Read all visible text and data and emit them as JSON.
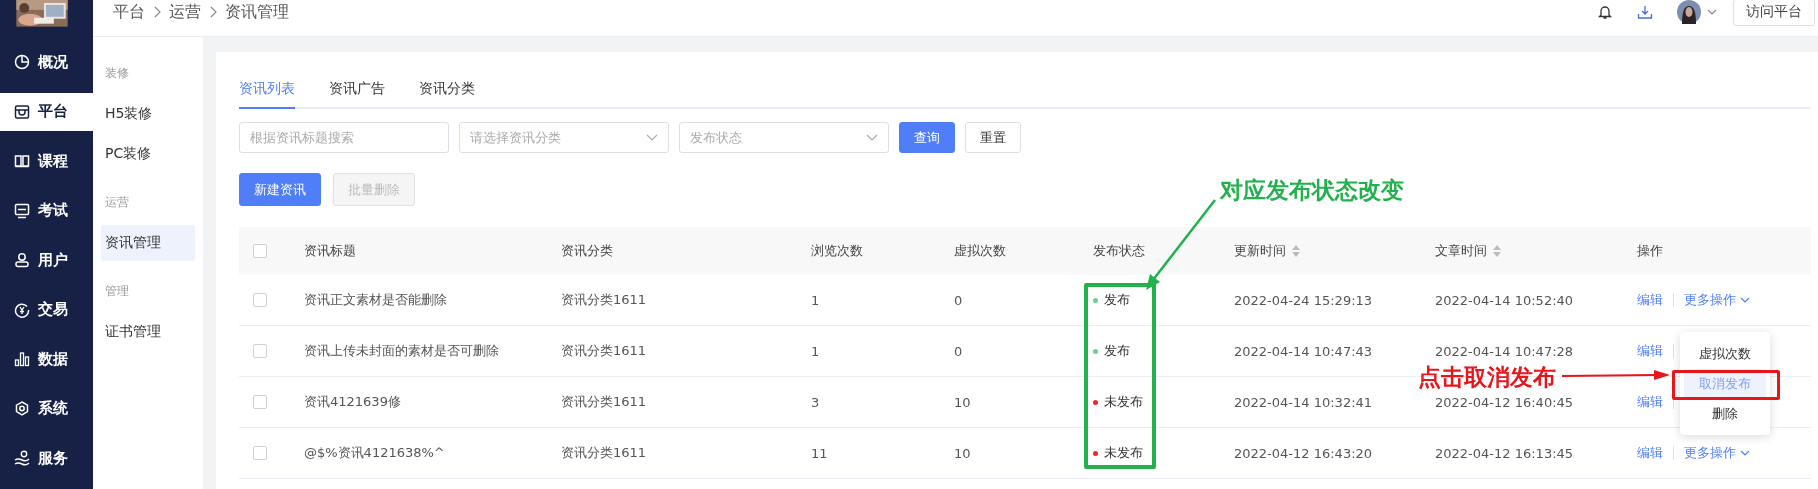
{
  "nav": {
    "items": [
      {
        "label": "概况",
        "selected": false
      },
      {
        "label": "平台",
        "selected": true
      },
      {
        "label": "课程",
        "selected": false
      },
      {
        "label": "考试",
        "selected": false
      },
      {
        "label": "用户",
        "selected": false
      },
      {
        "label": "交易",
        "selected": false
      },
      {
        "label": "数据",
        "selected": false
      },
      {
        "label": "系统",
        "selected": false
      },
      {
        "label": "服务",
        "selected": false
      }
    ]
  },
  "header": {
    "breadcrumb": [
      "平台",
      "运营",
      "资讯管理"
    ],
    "visit_button": "访问平台"
  },
  "subnav": {
    "groups": [
      {
        "title": "装修",
        "items": [
          {
            "label": "H5装修",
            "selected": false
          },
          {
            "label": "PC装修",
            "selected": false
          }
        ]
      },
      {
        "title": "运营",
        "items": [
          {
            "label": "资讯管理",
            "selected": true
          }
        ]
      },
      {
        "title": "管理",
        "items": [
          {
            "label": "证书管理",
            "selected": false
          }
        ]
      }
    ]
  },
  "tabs": [
    {
      "label": "资讯列表",
      "selected": true
    },
    {
      "label": "资讯广告",
      "selected": false
    },
    {
      "label": "资讯分类",
      "selected": false
    }
  ],
  "filters": {
    "search": {
      "placeholder": "根据资讯标题搜索"
    },
    "category": {
      "placeholder": "请选择资讯分类"
    },
    "status": {
      "placeholder": "发布状态"
    },
    "query_button": "查询",
    "reset_button": "重置"
  },
  "actions": [
    {
      "label": "新建资讯",
      "disabled": false
    },
    {
      "label": "批量删除",
      "disabled": true
    }
  ],
  "table": {
    "all_checked": false,
    "columns": [
      {
        "label": "资讯标题",
        "sortable": false
      },
      {
        "label": "资讯分类",
        "sortable": false
      },
      {
        "label": "浏览次数",
        "sortable": false
      },
      {
        "label": "虚拟次数",
        "sortable": false
      },
      {
        "label": "发布状态",
        "sortable": false
      },
      {
        "label": "更新时间",
        "sortable": true
      },
      {
        "label": "文章时间",
        "sortable": true
      },
      {
        "label": "操作",
        "sortable": false
      }
    ],
    "rows": [
      {
        "checked": false,
        "title": "资讯正文素材是否能删除",
        "category": "资讯分类1611",
        "views": "1",
        "virtual": "0",
        "status": {
          "text": "发布",
          "color": "#6cce8f"
        },
        "updated": "2022-04-24 15:29:13",
        "created": "2022-04-14 10:52:40",
        "actions": [
          "编辑",
          "更多操作"
        ]
      },
      {
        "checked": false,
        "title": "资讯上传未封面的素材是否可删除",
        "category": "资讯分类1611",
        "views": "1",
        "virtual": "0",
        "status": {
          "text": "发布",
          "color": "#6cce8f"
        },
        "updated": "2022-04-14 10:47:43",
        "created": "2022-04-14 10:47:28",
        "actions": [
          "编辑"
        ]
      },
      {
        "checked": false,
        "title": "资讯4121639修",
        "category": "资讯分类1611",
        "views": "3",
        "virtual": "10",
        "status": {
          "text": "未发布",
          "color": "#f5222d"
        },
        "updated": "2022-04-14 10:32:41",
        "created": "2022-04-12 16:40:45",
        "actions": [
          "编辑"
        ]
      },
      {
        "checked": false,
        "title": "@$%资讯4121638%^",
        "category": "资讯分类1611",
        "views": "11",
        "virtual": "10",
        "status": {
          "text": "未发布",
          "color": "#f5222d"
        },
        "updated": "2022-04-12 16:43:20",
        "created": "2022-04-12 16:13:45",
        "actions": [
          "编辑",
          "更多操作"
        ]
      }
    ]
  },
  "more_menu": {
    "items": [
      {
        "label": "虚拟次数",
        "selected": false
      },
      {
        "label": "取消发布",
        "selected": true
      },
      {
        "label": "删除",
        "selected": false
      }
    ]
  },
  "annotations": [
    {
      "text": "对应发布状态改变",
      "color": "#22b14c"
    },
    {
      "text": "点击取消发布",
      "color": "#e8151b"
    }
  ]
}
